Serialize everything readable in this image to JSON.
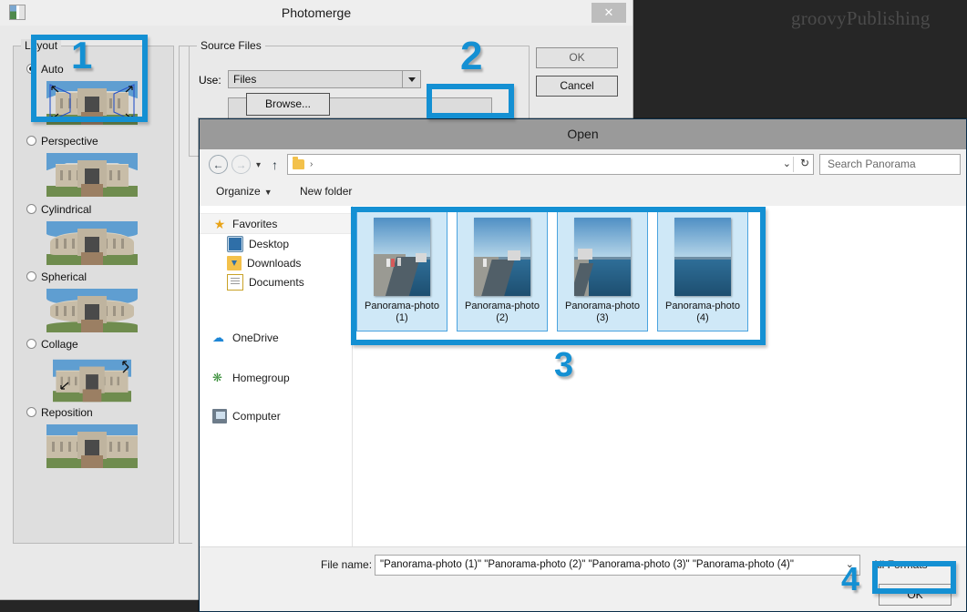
{
  "desktop": {
    "watermark": "groovyPublishing"
  },
  "photomerge": {
    "title": "Photomerge",
    "close_label": "✕",
    "layout": {
      "legend": "Layout",
      "options": [
        {
          "label": "Auto",
          "selected": true
        },
        {
          "label": "Perspective",
          "selected": false
        },
        {
          "label": "Cylindrical",
          "selected": false
        },
        {
          "label": "Spherical",
          "selected": false
        },
        {
          "label": "Collage",
          "selected": false
        },
        {
          "label": "Reposition",
          "selected": false
        }
      ]
    },
    "source_files": {
      "legend": "Source Files",
      "use_label": "Use:",
      "use_value": "Files",
      "browse_label": "Browse..."
    },
    "ok_label": "OK",
    "cancel_label": "Cancel"
  },
  "open_dialog": {
    "title": "Open",
    "nav": {
      "back_icon": "←",
      "forward_icon": "→",
      "recent_icon": "▾",
      "up_icon": "↑",
      "folder_icon": "folder-icon",
      "breadcrumb_separator": "›",
      "breadcrumb_path": "",
      "history_icon": "⌄",
      "refresh_icon": "↻",
      "search_placeholder": "Search Panorama"
    },
    "toolbar": {
      "organize_label": "Organize",
      "organize_caret": "▼",
      "new_folder_label": "New folder"
    },
    "places": [
      {
        "label": "Favorites",
        "icon": "star-icon",
        "indent": 0,
        "selected": true
      },
      {
        "label": "Desktop",
        "icon": "desktop-icon",
        "indent": 1,
        "selected": false
      },
      {
        "label": "Downloads",
        "icon": "downloads-icon",
        "indent": 1,
        "selected": false
      },
      {
        "label": "Documents",
        "icon": "documents-icon",
        "indent": 1,
        "selected": false
      },
      {
        "label": "OneDrive",
        "icon": "cloud-icon",
        "indent": 0,
        "selected": false
      },
      {
        "label": "Homegroup",
        "icon": "homegroup-icon",
        "indent": 0,
        "selected": false
      },
      {
        "label": "Computer",
        "icon": "computer-icon",
        "indent": 0,
        "selected": false
      }
    ],
    "files": [
      {
        "name_line1": "Panorama-photo",
        "name_line2": "(1)",
        "selected": true
      },
      {
        "name_line1": "Panorama-photo",
        "name_line2": "(2)",
        "selected": true
      },
      {
        "name_line1": "Panorama-photo",
        "name_line2": "(3)",
        "selected": true
      },
      {
        "name_line1": "Panorama-photo",
        "name_line2": "(4)",
        "selected": true
      }
    ],
    "footer": {
      "file_name_label": "File name:",
      "file_name_value": "\"Panorama-photo (1)\" \"Panorama-photo (2)\" \"Panorama-photo (3)\" \"Panorama-photo (4)\"",
      "file_name_caret": "⌄",
      "format_filter": "All Formats",
      "ok_label": "OK"
    }
  },
  "annotations": {
    "color": "#1490d3",
    "steps": [
      {
        "number": "1",
        "target": "layout-auto"
      },
      {
        "number": "2",
        "target": "browse-button"
      },
      {
        "number": "3",
        "target": "file-selection"
      },
      {
        "number": "4",
        "target": "open-ok-button"
      }
    ]
  }
}
